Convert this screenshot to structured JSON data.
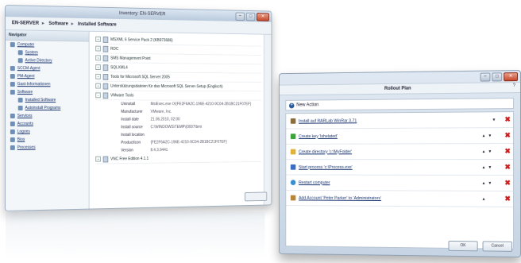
{
  "inventory": {
    "title": "Inventory: EN-SERVER",
    "breadcrumb": [
      "EN-SERVER",
      "Software",
      "Installed Software"
    ],
    "nav": {
      "header": "Navigator",
      "items": [
        {
          "label": "Computer",
          "icon": "computer-icon",
          "children": [
            "System",
            "Active Directory"
          ]
        },
        {
          "label": "SCCM-Agent",
          "icon": "agent-icon"
        },
        {
          "label": "PM-Agent",
          "icon": "agent-icon"
        },
        {
          "label": "Gast-Informationen",
          "icon": "info-icon"
        },
        {
          "label": "Software",
          "icon": "software-icon",
          "children": [
            "Installed Software",
            "Autoinstall Programs"
          ]
        },
        {
          "label": "Services",
          "icon": "services-icon"
        },
        {
          "label": "Accounts",
          "icon": "accounts-icon"
        },
        {
          "label": "Logons",
          "icon": "logons-icon"
        },
        {
          "label": "Bios",
          "icon": "bios-icon"
        },
        {
          "label": "Processes",
          "icon": "processes-icon"
        }
      ]
    },
    "tree": [
      "MSXML 6 Service Pack 2 (KB973686)",
      "RDC",
      "SMS Management Point",
      "SQLXML4",
      "Tools for Microsoft SQL Server 2005",
      "Unterstützungsdateien für das Microsoft SQL Server-Setup (Englisch)",
      "VMware Tools"
    ],
    "details": [
      {
        "k": "Uninstall",
        "v": "MsiExec.exe /X{FE2F6A2C-196E-4210-9C04-2B1BC21F07EF}"
      },
      {
        "k": "Manufacturer",
        "v": "VMware, Inc."
      },
      {
        "k": "Install date",
        "v": "21.06.2010, 02:00"
      },
      {
        "k": "Install source",
        "v": "C:\\WINDOWS\\TEMP\\{0007\\bmi"
      },
      {
        "k": "Install location",
        "v": ""
      },
      {
        "k": "ProductIcon",
        "v": "{FE2F6A2C-196E-4210-9C04-2B1BC21F07EF}"
      },
      {
        "k": "Version",
        "v": "8.4.3.9441"
      }
    ],
    "last_row": "VNC Free Edition 4.1.1"
  },
  "rollout": {
    "title": "Rollout Plan",
    "help": "?",
    "new_action": "New Action",
    "actions": [
      {
        "label": "Install auf RARLab WinRar 3.71",
        "icon_color": "#8a6d3b",
        "up": false,
        "down": true
      },
      {
        "label": "Create key 'lshelated'",
        "icon_color": "#3aa33a",
        "up": true,
        "down": true
      },
      {
        "label": "Create directory 'c:\\MyFolder'",
        "icon_color": "#e0b23a",
        "up": true,
        "down": true
      },
      {
        "label": "Start process 'c:\\Process.exe'",
        "icon_color": "#3a6ec4",
        "up": true,
        "down": true
      },
      {
        "label": "Restart computer",
        "icon_color": "#3a8fd0",
        "up": true,
        "down": true
      },
      {
        "label": "Add Account 'Peter Parker' to 'Administrators'",
        "icon_color": "#b8863a",
        "up": true,
        "down": false
      }
    ],
    "ok": "OK",
    "cancel": "Cancel"
  }
}
